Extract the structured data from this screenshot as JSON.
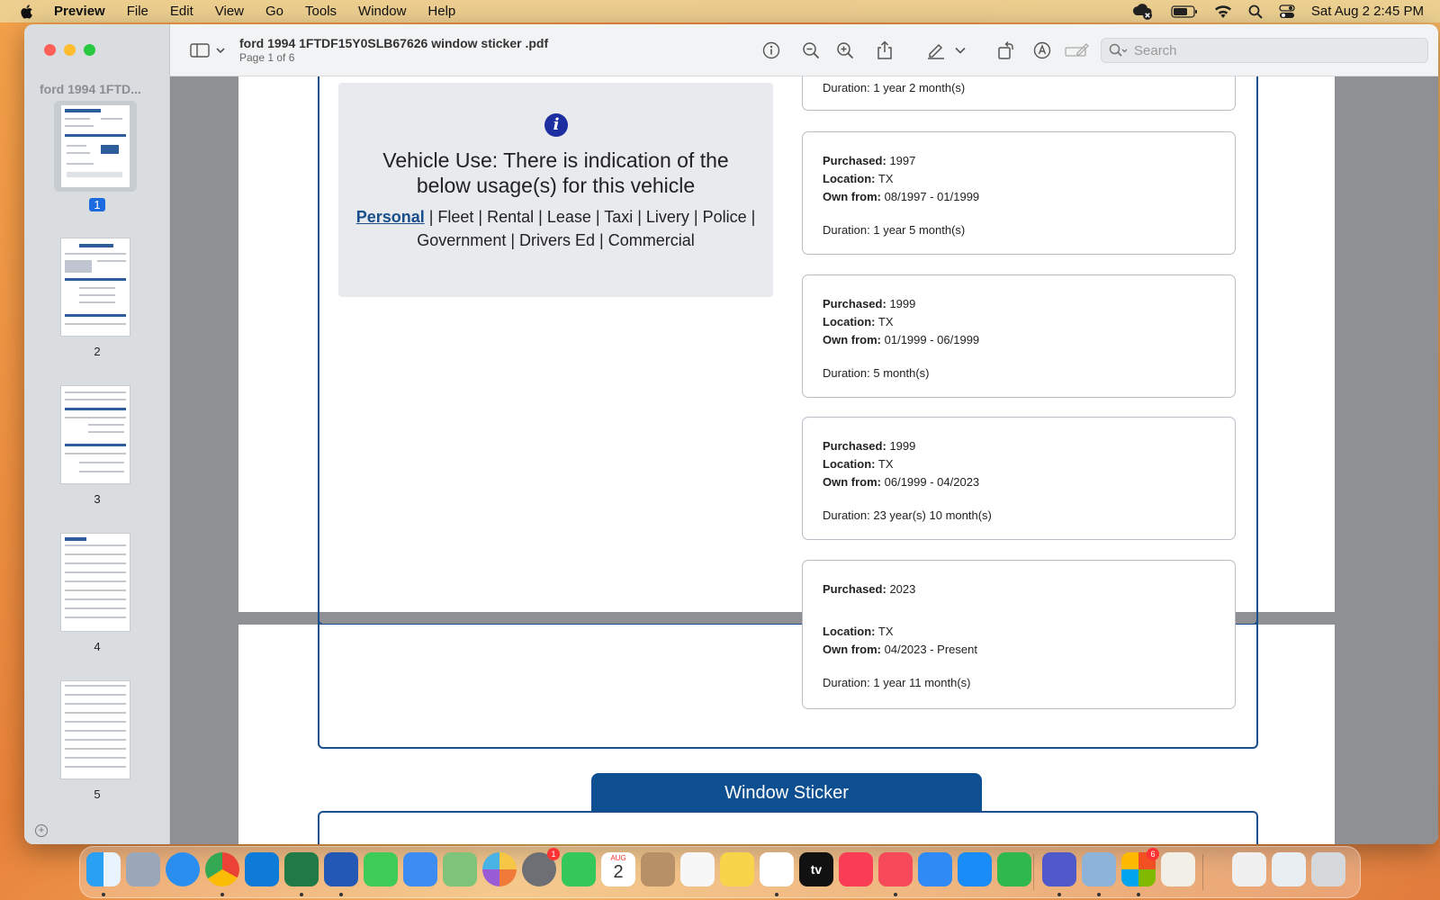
{
  "menubar": {
    "app_name": "Preview",
    "items": [
      "File",
      "Edit",
      "View",
      "Go",
      "Tools",
      "Window",
      "Help"
    ],
    "clock": "Sat Aug 2  2:45 PM"
  },
  "window": {
    "doc_title": "ford 1994 1FTDF15Y0SLB67626 window sticker .pdf",
    "page_indicator": "Page 1 of 6",
    "search_placeholder": "Search",
    "sidebar_title": "ford 1994 1FTD..."
  },
  "thumbnails": [
    {
      "label": "1",
      "selected": true
    },
    {
      "label": "2",
      "selected": false
    },
    {
      "label": "3",
      "selected": false
    },
    {
      "label": "4",
      "selected": false
    },
    {
      "label": "5",
      "selected": false
    }
  ],
  "vehicle_use": {
    "headline": "Vehicle Use: There is indication of the below usage(s) for this vehicle",
    "highlighted_use": "Personal",
    "other_uses": " | Fleet | Rental | Lease | Taxi | Livery | Police | Government | Drivers Ed | Commercial"
  },
  "owners": {
    "labels": {
      "purchased": "Purchased:",
      "location": "Location:",
      "own_from": "Own from:"
    },
    "top_partial_duration": "Duration: 1 year 2 month(s)",
    "cards": [
      {
        "purchased": "1997",
        "location": "TX",
        "own_from": "08/1997 - 01/1999",
        "duration": "Duration: 1 year 5 month(s)"
      },
      {
        "purchased": "1999",
        "location": "TX",
        "own_from": "01/1999 - 06/1999",
        "duration": "Duration: 5 month(s)"
      },
      {
        "purchased": "1999",
        "location": "TX",
        "own_from": "06/1999 - 04/2023",
        "duration": "Duration: 23 year(s) 10 month(s)"
      },
      {
        "purchased": "2023",
        "location": "TX",
        "own_from": "04/2023 - Present",
        "duration": "Duration: 1 year 11 month(s)"
      }
    ]
  },
  "window_sticker_tab": "Window Sticker",
  "dock": {
    "badges": {
      "system_settings": "1",
      "microsoft_office": "6"
    },
    "calendar_month": "AUG",
    "calendar_day": "2",
    "tv_label": "tv"
  },
  "colors": {
    "accent": "#1b4f8c",
    "tab": "#0e4f91"
  }
}
